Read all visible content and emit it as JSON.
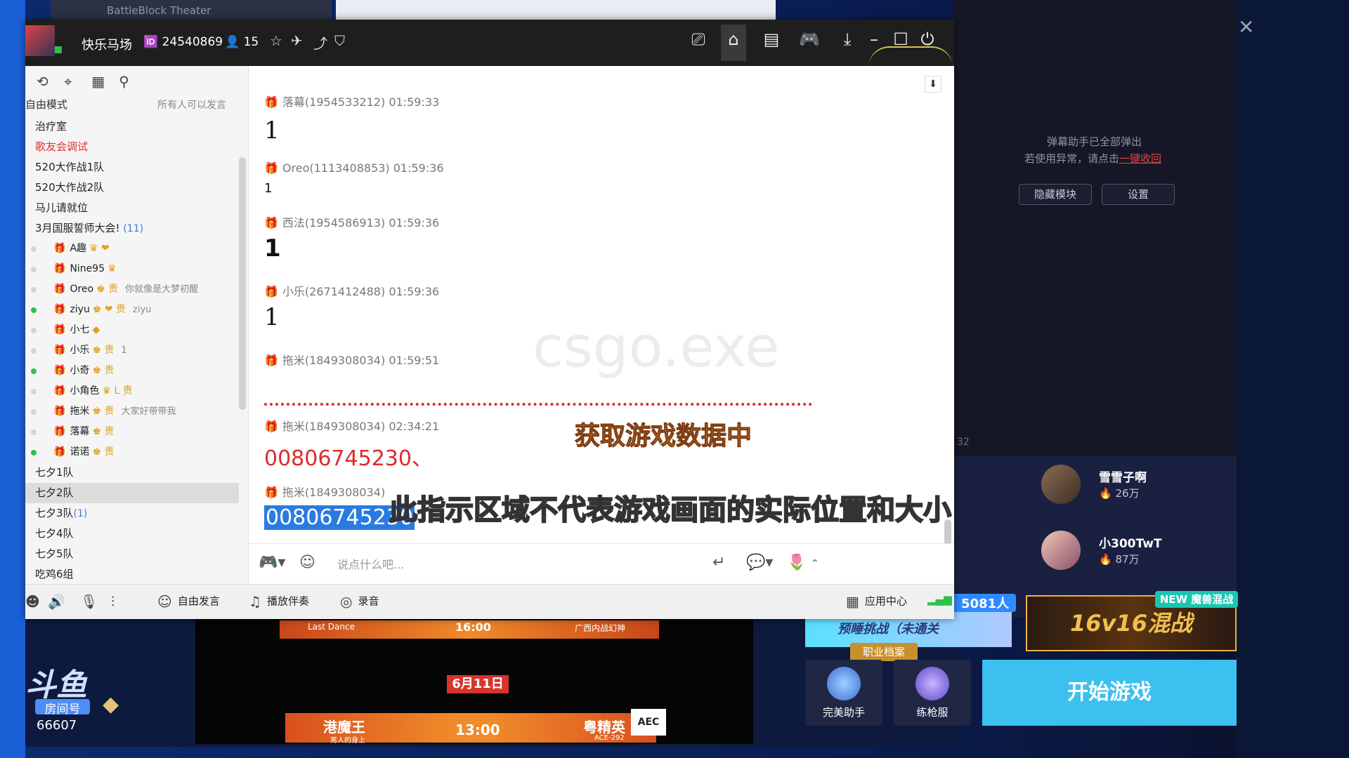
{
  "background": {
    "top_window_title": "BattleBlock Theater",
    "stream": {
      "top_banner_left": "Last Dance",
      "top_banner_time": "16:00",
      "top_banner_right": "广西内战幻神",
      "date": "6月11日",
      "team_left": "港魔王",
      "team_left_sub": "男人的身上",
      "time": "13:00",
      "team_right": "粤精英",
      "team_right_sub": "ACE-292",
      "logo_text": "AEC"
    },
    "douyu": {
      "logo": "斗鱼",
      "room_label": "房间号",
      "room_number": "66607"
    }
  },
  "right_panel": {
    "note_line1": "弹幕助手已全部弹出",
    "note_line2_prefix": "若使用异常，请点击",
    "note_link": "一键收回",
    "hide_button": "隐藏模块",
    "settings_button": "设置",
    "side_count": "32",
    "users": [
      {
        "name": "雪雪子啊",
        "fans": "26万"
      },
      {
        "name": "小300TwT",
        "fans": "87万"
      }
    ],
    "online_count": "5081人",
    "challenge_text": "预睡挑战（未通关",
    "career_tag": "职业档案",
    "new_tag": "NEW 魔兽混战",
    "promo_text": "16v16混战",
    "tools": [
      "完美助手",
      "练枪服"
    ],
    "start_button": "开始游戏"
  },
  "titlebar": {
    "channel_name": "快乐马场",
    "channel_id": "24540869",
    "user_count": "15",
    "icons": [
      "star-icon",
      "plane-icon",
      "share-icon",
      "shield-icon"
    ],
    "right_icons": [
      "video-icon",
      "home-icon",
      "list-icon",
      "gamepad-icon",
      "download-icon",
      "minimize-icon",
      "maximize-icon",
      "power-icon"
    ]
  },
  "left_panel": {
    "mode_label": "自由模式",
    "mode_right": "所有人可以发言",
    "channels_top": [
      {
        "name": "治疗室",
        "style": ""
      },
      {
        "name": "歌友会调试",
        "style": "red"
      },
      {
        "name": "520大作战1队",
        "style": ""
      },
      {
        "name": "520大作战2队",
        "style": ""
      },
      {
        "name": "马儿请就位",
        "style": ""
      }
    ],
    "group": {
      "name": "3月国服誓师大会!",
      "count": "(11)"
    },
    "members": [
      {
        "name": "A趣",
        "badges": "♛ ❤",
        "sig": "",
        "online": false,
        "gift": "gold"
      },
      {
        "name": "Nine95",
        "badges": "♛",
        "sig": "",
        "online": false,
        "gift": "gold"
      },
      {
        "name": "Oreo",
        "badges": "♚ 贵",
        "sig": "你就像是大梦初醒",
        "online": false,
        "gift": "gold"
      },
      {
        "name": "ziyu",
        "badges": "♚ ❤ 贵",
        "sig": "ziyu",
        "online": true,
        "gift": "gold"
      },
      {
        "name": "小七",
        "badges": "◆",
        "sig": "",
        "online": false,
        "gift": "gold"
      },
      {
        "name": "小乐",
        "badges": "♚ 贵",
        "sig": "1",
        "online": false,
        "gift": "gold"
      },
      {
        "name": "小奇",
        "badges": "♚ 贵",
        "sig": "",
        "online": true,
        "gift": "gold"
      },
      {
        "name": "小角色",
        "badges": "♛ L 贵",
        "sig": "",
        "online": false,
        "gift": "gold"
      },
      {
        "name": "拖米",
        "badges": "♚ 贵",
        "sig": "大家好带带我",
        "online": false,
        "gift": "purple"
      },
      {
        "name": "落幕",
        "badges": "♚ 贵",
        "sig": "",
        "online": false,
        "gift": "gold"
      },
      {
        "name": "诺诺",
        "badges": "♚ 贵",
        "sig": "",
        "online": true,
        "gift": "gold"
      }
    ],
    "channels_bottom": [
      {
        "name": "七夕1队",
        "cnt": ""
      },
      {
        "name": "七夕2队",
        "cnt": ""
      },
      {
        "name": "七夕3队",
        "cnt": "(1)"
      },
      {
        "name": "七夕4队",
        "cnt": ""
      },
      {
        "name": "七夕5队",
        "cnt": ""
      },
      {
        "name": "吃鸡6组",
        "cnt": ""
      }
    ]
  },
  "chat": {
    "messages": [
      {
        "sender": "落幕(1954533212)",
        "time": "01:59:33",
        "text": "1"
      },
      {
        "sender": "Oreo(1113408853)",
        "time": "01:59:36",
        "text": "1"
      },
      {
        "sender": "西法(1954586913)",
        "time": "01:59:36",
        "text": "1"
      },
      {
        "sender": "小乐(2671412488)",
        "time": "01:59:36",
        "text": "1"
      },
      {
        "sender": "拖米(1849308034)",
        "time": "01:59:51",
        "text": ""
      },
      {
        "sender": "拖米(1849308034)",
        "time": "02:34:21",
        "text": "00806745230、"
      },
      {
        "sender": "拖米(1849308034)",
        "time": "",
        "text": "00806745230"
      }
    ],
    "watermark": "csgo.exe",
    "loading_text": "获取游戏数据中",
    "overlay_text": "此指示区域不代表游戏画面的实际位置和大小",
    "input_placeholder": "说点什么吧..."
  },
  "bottom_bar": {
    "free_speak": "自由发言",
    "play_music": "播放伴奏",
    "record": "录音",
    "app_center": "应用中心"
  }
}
